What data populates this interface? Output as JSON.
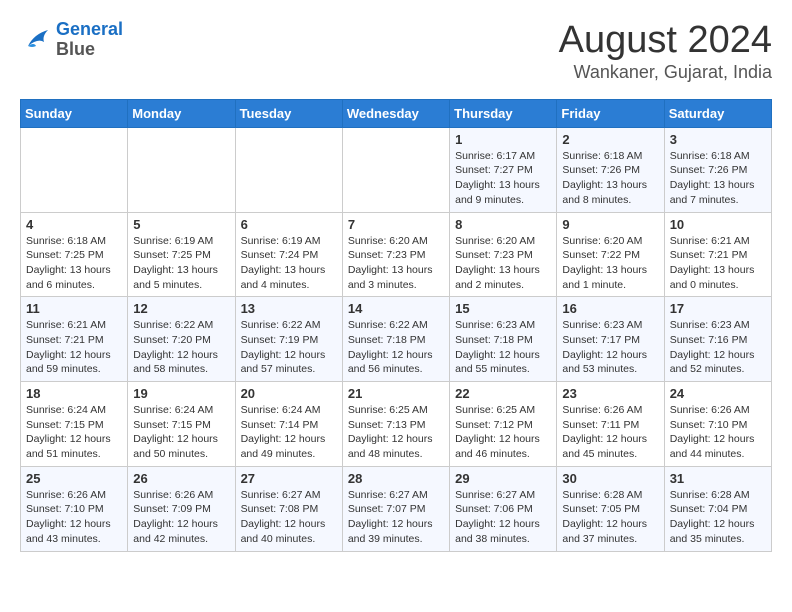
{
  "header": {
    "logo_line1": "General",
    "logo_line2": "Blue",
    "title": "August 2024",
    "subtitle": "Wankaner, Gujarat, India"
  },
  "days_of_week": [
    "Sunday",
    "Monday",
    "Tuesday",
    "Wednesday",
    "Thursday",
    "Friday",
    "Saturday"
  ],
  "weeks": [
    [
      {
        "day": "",
        "info": ""
      },
      {
        "day": "",
        "info": ""
      },
      {
        "day": "",
        "info": ""
      },
      {
        "day": "",
        "info": ""
      },
      {
        "day": "1",
        "info": "Sunrise: 6:17 AM\nSunset: 7:27 PM\nDaylight: 13 hours\nand 9 minutes."
      },
      {
        "day": "2",
        "info": "Sunrise: 6:18 AM\nSunset: 7:26 PM\nDaylight: 13 hours\nand 8 minutes."
      },
      {
        "day": "3",
        "info": "Sunrise: 6:18 AM\nSunset: 7:26 PM\nDaylight: 13 hours\nand 7 minutes."
      }
    ],
    [
      {
        "day": "4",
        "info": "Sunrise: 6:18 AM\nSunset: 7:25 PM\nDaylight: 13 hours\nand 6 minutes."
      },
      {
        "day": "5",
        "info": "Sunrise: 6:19 AM\nSunset: 7:25 PM\nDaylight: 13 hours\nand 5 minutes."
      },
      {
        "day": "6",
        "info": "Sunrise: 6:19 AM\nSunset: 7:24 PM\nDaylight: 13 hours\nand 4 minutes."
      },
      {
        "day": "7",
        "info": "Sunrise: 6:20 AM\nSunset: 7:23 PM\nDaylight: 13 hours\nand 3 minutes."
      },
      {
        "day": "8",
        "info": "Sunrise: 6:20 AM\nSunset: 7:23 PM\nDaylight: 13 hours\nand 2 minutes."
      },
      {
        "day": "9",
        "info": "Sunrise: 6:20 AM\nSunset: 7:22 PM\nDaylight: 13 hours\nand 1 minute."
      },
      {
        "day": "10",
        "info": "Sunrise: 6:21 AM\nSunset: 7:21 PM\nDaylight: 13 hours\nand 0 minutes."
      }
    ],
    [
      {
        "day": "11",
        "info": "Sunrise: 6:21 AM\nSunset: 7:21 PM\nDaylight: 12 hours\nand 59 minutes."
      },
      {
        "day": "12",
        "info": "Sunrise: 6:22 AM\nSunset: 7:20 PM\nDaylight: 12 hours\nand 58 minutes."
      },
      {
        "day": "13",
        "info": "Sunrise: 6:22 AM\nSunset: 7:19 PM\nDaylight: 12 hours\nand 57 minutes."
      },
      {
        "day": "14",
        "info": "Sunrise: 6:22 AM\nSunset: 7:18 PM\nDaylight: 12 hours\nand 56 minutes."
      },
      {
        "day": "15",
        "info": "Sunrise: 6:23 AM\nSunset: 7:18 PM\nDaylight: 12 hours\nand 55 minutes."
      },
      {
        "day": "16",
        "info": "Sunrise: 6:23 AM\nSunset: 7:17 PM\nDaylight: 12 hours\nand 53 minutes."
      },
      {
        "day": "17",
        "info": "Sunrise: 6:23 AM\nSunset: 7:16 PM\nDaylight: 12 hours\nand 52 minutes."
      }
    ],
    [
      {
        "day": "18",
        "info": "Sunrise: 6:24 AM\nSunset: 7:15 PM\nDaylight: 12 hours\nand 51 minutes."
      },
      {
        "day": "19",
        "info": "Sunrise: 6:24 AM\nSunset: 7:15 PM\nDaylight: 12 hours\nand 50 minutes."
      },
      {
        "day": "20",
        "info": "Sunrise: 6:24 AM\nSunset: 7:14 PM\nDaylight: 12 hours\nand 49 minutes."
      },
      {
        "day": "21",
        "info": "Sunrise: 6:25 AM\nSunset: 7:13 PM\nDaylight: 12 hours\nand 48 minutes."
      },
      {
        "day": "22",
        "info": "Sunrise: 6:25 AM\nSunset: 7:12 PM\nDaylight: 12 hours\nand 46 minutes."
      },
      {
        "day": "23",
        "info": "Sunrise: 6:26 AM\nSunset: 7:11 PM\nDaylight: 12 hours\nand 45 minutes."
      },
      {
        "day": "24",
        "info": "Sunrise: 6:26 AM\nSunset: 7:10 PM\nDaylight: 12 hours\nand 44 minutes."
      }
    ],
    [
      {
        "day": "25",
        "info": "Sunrise: 6:26 AM\nSunset: 7:10 PM\nDaylight: 12 hours\nand 43 minutes."
      },
      {
        "day": "26",
        "info": "Sunrise: 6:26 AM\nSunset: 7:09 PM\nDaylight: 12 hours\nand 42 minutes."
      },
      {
        "day": "27",
        "info": "Sunrise: 6:27 AM\nSunset: 7:08 PM\nDaylight: 12 hours\nand 40 minutes."
      },
      {
        "day": "28",
        "info": "Sunrise: 6:27 AM\nSunset: 7:07 PM\nDaylight: 12 hours\nand 39 minutes."
      },
      {
        "day": "29",
        "info": "Sunrise: 6:27 AM\nSunset: 7:06 PM\nDaylight: 12 hours\nand 38 minutes."
      },
      {
        "day": "30",
        "info": "Sunrise: 6:28 AM\nSunset: 7:05 PM\nDaylight: 12 hours\nand 37 minutes."
      },
      {
        "day": "31",
        "info": "Sunrise: 6:28 AM\nSunset: 7:04 PM\nDaylight: 12 hours\nand 35 minutes."
      }
    ]
  ]
}
